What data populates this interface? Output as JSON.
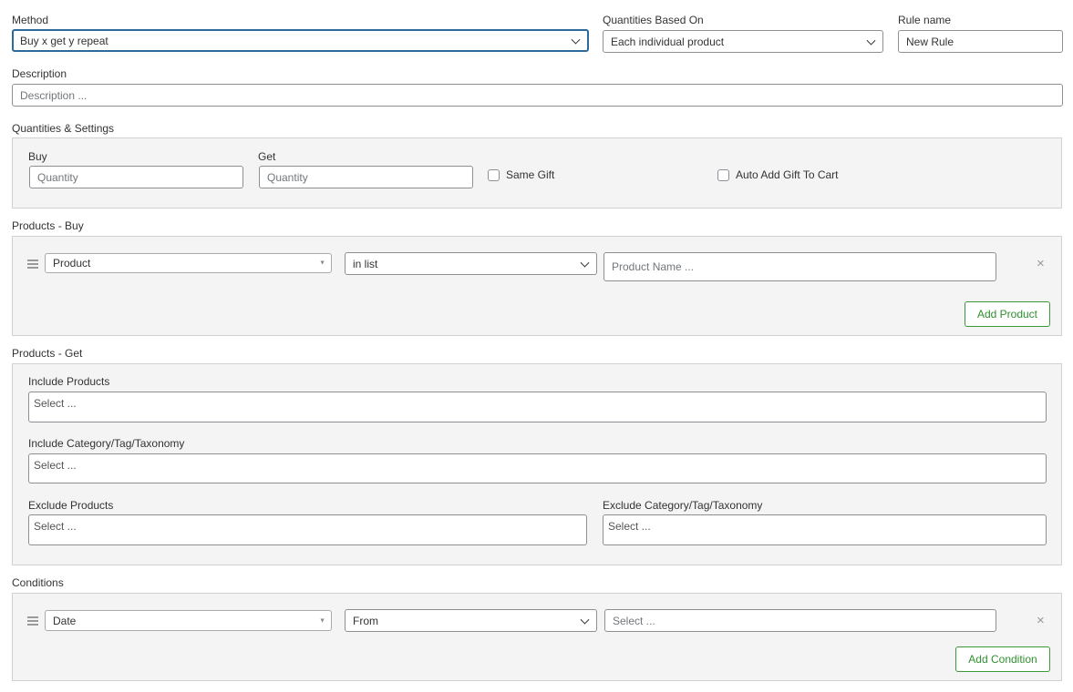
{
  "header": {
    "method_label": "Method",
    "method_value": "Buy x get y repeat",
    "qty_based_label": "Quantities Based On",
    "qty_based_value": "Each individual product",
    "rule_name_label": "Rule name",
    "rule_name_value": "New Rule"
  },
  "description": {
    "label": "Description",
    "placeholder": "Description ..."
  },
  "quantities": {
    "section_title": "Quantities & Settings",
    "buy_label": "Buy",
    "buy_placeholder": "Quantity",
    "get_label": "Get",
    "get_placeholder": "Quantity",
    "same_gift_label": "Same Gift",
    "same_gift_checked": false,
    "auto_add_label": "Auto Add Gift To Cart",
    "auto_add_checked": false
  },
  "products_buy": {
    "section_title": "Products - Buy",
    "type_value": "Product",
    "operator_value": "in list",
    "name_placeholder": "Product Name ...",
    "add_button": "Add Product",
    "remove_icon": "×"
  },
  "products_get": {
    "section_title": "Products - Get",
    "include_products_label": "Include Products",
    "include_products_placeholder": "Select ...",
    "include_category_label": "Include Category/Tag/Taxonomy",
    "include_category_placeholder": "Select ...",
    "exclude_products_label": "Exclude Products",
    "exclude_products_placeholder": "Select ...",
    "exclude_category_label": "Exclude Category/Tag/Taxonomy",
    "exclude_category_placeholder": "Select ..."
  },
  "conditions": {
    "section_title": "Conditions",
    "type_value": "Date",
    "operator_value": "From",
    "value_placeholder": "Select ...",
    "add_button": "Add Condition",
    "remove_icon": "×"
  },
  "colors": {
    "focus_border": "#2c6a9a",
    "button_green": "#2f8f2f",
    "panel_bg": "#f4f4f4"
  }
}
